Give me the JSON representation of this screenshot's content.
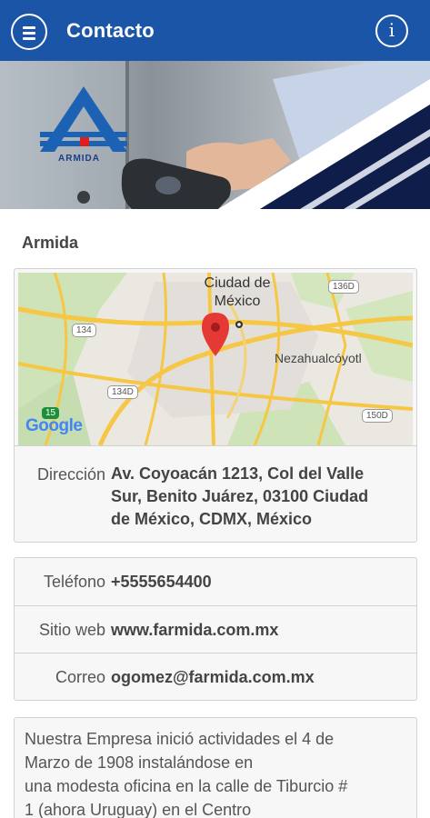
{
  "app_bar": {
    "title": "Contacto"
  },
  "company": {
    "name": "Armida",
    "logo_text": "ARMIDA"
  },
  "map": {
    "labels": {
      "city": "Ciudad de México",
      "nezahualcoyotl": "Nezahualcóyotl",
      "road_136d": "136D",
      "road_134": "134",
      "road_134d": "134D",
      "road_15": "15",
      "road_150d": "150D"
    },
    "google_logo": "Google",
    "colors": {
      "pin": "#e53935",
      "road": "#f6c744",
      "urban": "#e8e5e0",
      "park": "#c8dfb0"
    }
  },
  "address": {
    "label": "Dirección",
    "lines": [
      "Av. Coyoacán 1213, Col del Valle",
      "Sur, Benito Juárez, 03100 Ciudad",
      "de México, CDMX, México"
    ]
  },
  "contact": {
    "phone_label": "Teléfono",
    "phone": "+5555654400",
    "website_label": "Sitio web",
    "website": "www.farmida.com.mx",
    "email_label": "Correo",
    "email": "ogomez@farmida.com.mx"
  },
  "about": {
    "lines": [
      "Nuestra Empresa inició actividades el 4 de",
      "Marzo de 1908 instalándose en",
      "una modesta oficina en la calle de Tiburcio #",
      "1 (ahora Uruguay) en el Centro"
    ]
  },
  "colors": {
    "app_bar": "#1a55a8",
    "card_bg": "#f7f7f7"
  }
}
